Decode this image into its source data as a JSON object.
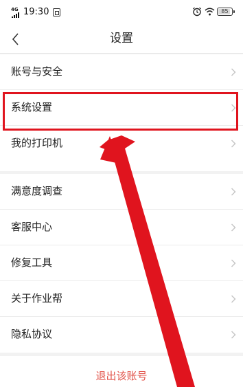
{
  "status_bar": {
    "signal_text": "4G",
    "time": "19:30",
    "battery": "85"
  },
  "nav": {
    "title": "设置"
  },
  "settings": {
    "group1": [
      {
        "label": "账号与安全"
      },
      {
        "label": "系统设置"
      },
      {
        "label": "我的打印机"
      }
    ],
    "group2": [
      {
        "label": "满意度调查"
      },
      {
        "label": "客服中心"
      },
      {
        "label": "修复工具"
      },
      {
        "label": "关于作业帮"
      },
      {
        "label": "隐私协议"
      }
    ]
  },
  "logout": {
    "label": "退出该账号"
  },
  "colors": {
    "highlight": "#e0141e",
    "logout_text": "#e2534a"
  }
}
